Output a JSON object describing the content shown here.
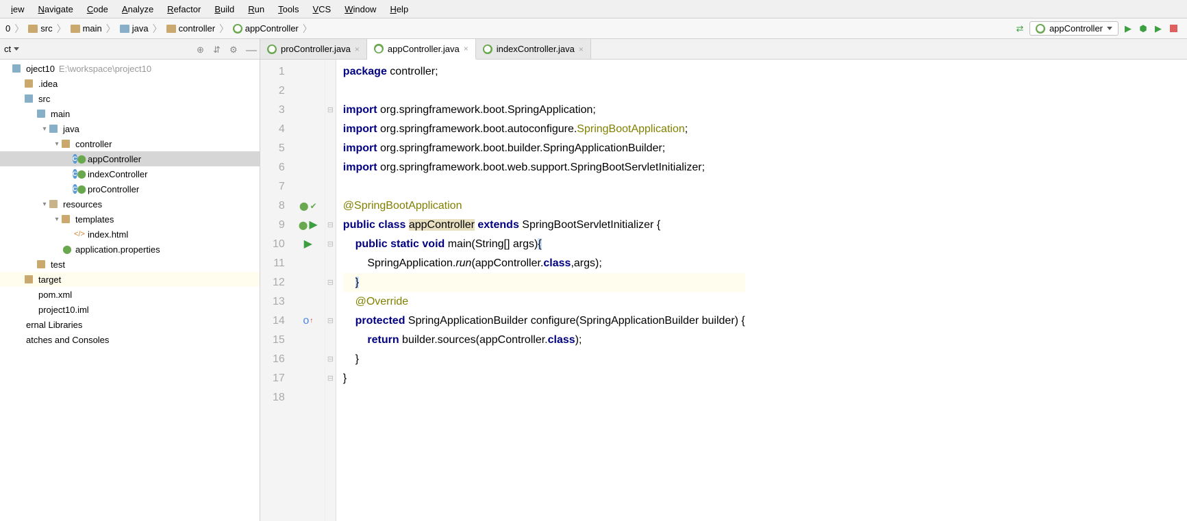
{
  "menu": [
    "iew",
    "Navigate",
    "Code",
    "Analyze",
    "Refactor",
    "Build",
    "Run",
    "Tools",
    "VCS",
    "Window",
    "Help"
  ],
  "breadcrumb": {
    "items": [
      {
        "label": "0",
        "type": "root"
      },
      {
        "label": "src",
        "type": "folder"
      },
      {
        "label": "main",
        "type": "folder"
      },
      {
        "label": "java",
        "type": "folder-blue"
      },
      {
        "label": "controller",
        "type": "folder"
      },
      {
        "label": "appController",
        "type": "class"
      }
    ]
  },
  "runconfig": {
    "label": "appController"
  },
  "sidebar": {
    "title": "ct",
    "project": {
      "name": "oject10",
      "path": "E:\\workspace\\project10"
    }
  },
  "tree": [
    {
      "indent": 0,
      "arrow": "",
      "icon": "module",
      "label": "oject10",
      "hint": "E:\\workspace\\project10"
    },
    {
      "indent": 1,
      "arrow": "",
      "icon": "folder",
      "label": ".idea"
    },
    {
      "indent": 1,
      "arrow": "",
      "icon": "folder-blue",
      "label": "src"
    },
    {
      "indent": 2,
      "arrow": "",
      "icon": "folder-blue",
      "label": "main"
    },
    {
      "indent": 3,
      "arrow": "v",
      "icon": "folder-blue",
      "label": "java"
    },
    {
      "indent": 4,
      "arrow": "v",
      "icon": "folder",
      "label": "controller"
    },
    {
      "indent": 5,
      "arrow": "",
      "icon": "class-spring",
      "label": "appController",
      "selected": true
    },
    {
      "indent": 5,
      "arrow": "",
      "icon": "class-spring",
      "label": "indexController"
    },
    {
      "indent": 5,
      "arrow": "",
      "icon": "class-spring",
      "label": "proController"
    },
    {
      "indent": 3,
      "arrow": "v",
      "icon": "folder-res",
      "label": "resources"
    },
    {
      "indent": 4,
      "arrow": "v",
      "icon": "folder",
      "label": "templates"
    },
    {
      "indent": 5,
      "arrow": "",
      "icon": "html",
      "label": "index.html"
    },
    {
      "indent": 4,
      "arrow": "",
      "icon": "spring",
      "label": "application.properties"
    },
    {
      "indent": 2,
      "arrow": "",
      "icon": "folder",
      "label": "test"
    },
    {
      "indent": 1,
      "arrow": "",
      "icon": "folder",
      "label": "target",
      "highlighted": true
    },
    {
      "indent": 1,
      "arrow": "",
      "icon": "file",
      "label": "pom.xml"
    },
    {
      "indent": 1,
      "arrow": "",
      "icon": "file",
      "label": "project10.iml"
    },
    {
      "indent": 0,
      "arrow": "",
      "icon": "lib",
      "label": "ernal Libraries"
    },
    {
      "indent": 0,
      "arrow": "",
      "icon": "scratch",
      "label": "atches and Consoles"
    }
  ],
  "tabs": [
    {
      "label": "proController.java",
      "active": false
    },
    {
      "label": "appController.java",
      "active": true
    },
    {
      "label": "indexController.java",
      "active": false
    }
  ],
  "code": {
    "lines": [
      {
        "n": 1,
        "html": "<span class='kw'>package</span> controller;"
      },
      {
        "n": 2,
        "html": ""
      },
      {
        "n": 3,
        "html": "<span class='kw'>import</span> org.springframework.boot.SpringApplication;",
        "fold": "-"
      },
      {
        "n": 4,
        "html": "<span class='kw'>import</span> org.springframework.boot.autoconfigure.<span class='warn'>SpringBootApplication</span>;"
      },
      {
        "n": 5,
        "html": "<span class='kw'>import</span> org.springframework.boot.builder.SpringApplicationBuilder;"
      },
      {
        "n": 6,
        "html": "<span class='kw'>import</span> org.springframework.boot.web.support.SpringBootServletInitializer;"
      },
      {
        "n": 7,
        "html": ""
      },
      {
        "n": 8,
        "html": "<span class='ann'>@SpringBootApplication</span>",
        "gutter": "leaf-leaf"
      },
      {
        "n": 9,
        "html": "<span class='kw'>public</span> <span class='kw'>class</span> <span class='cls-hl'>appController</span> <span class='kw'>extends</span> SpringBootServletInitializer {",
        "gutter": "leaf-play",
        "fold": "-"
      },
      {
        "n": 10,
        "html": "    <span class='kw'>public</span> <span class='kw'>static</span> <span class='kw'>void</span> main(String[] args)<span class='sel-brace'>{</span>",
        "gutter": "play",
        "fold": "-"
      },
      {
        "n": 11,
        "html": "        SpringApplication.<span class='it'>run</span>(appController.<span class='kw'>class</span>,args);"
      },
      {
        "n": 12,
        "html": "    <span class='sel-brace'>}</span>",
        "hl": true,
        "fold": "-"
      },
      {
        "n": 13,
        "html": "    <span class='ann'>@Override</span>"
      },
      {
        "n": 14,
        "html": "    <span class='kw'>protected</span> SpringApplicationBuilder configure(SpringApplicationBuilder builder) {",
        "gutter": "override",
        "fold": "-"
      },
      {
        "n": 15,
        "html": "        <span class='kw'>return</span> builder.sources(appController.<span class='kw'>class</span>);"
      },
      {
        "n": 16,
        "html": "    }",
        "fold": "-"
      },
      {
        "n": 17,
        "html": "}",
        "fold": "-"
      },
      {
        "n": 18,
        "html": ""
      }
    ]
  }
}
